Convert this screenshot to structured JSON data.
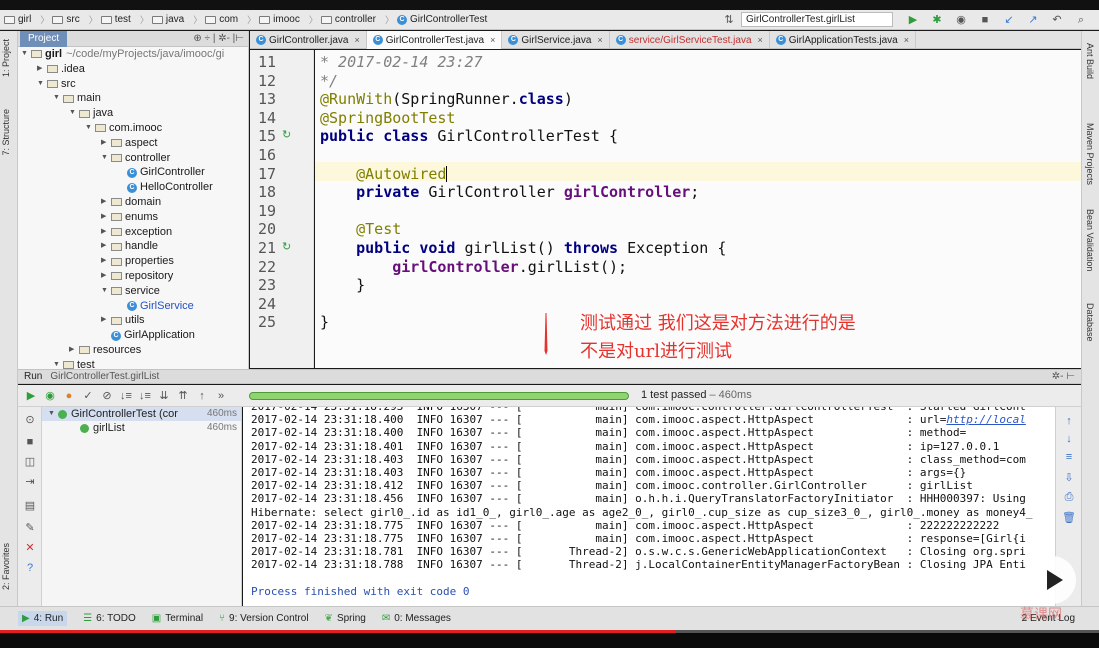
{
  "breadcrumb": [
    {
      "label": "girl",
      "icon": "folder-icon"
    },
    {
      "label": "src",
      "icon": "folder-icon"
    },
    {
      "label": "test",
      "icon": "folder-icon"
    },
    {
      "label": "java",
      "icon": "folder-icon"
    },
    {
      "label": "com",
      "icon": "folder-icon"
    },
    {
      "label": "imooc",
      "icon": "folder-icon"
    },
    {
      "label": "controller",
      "icon": "folder-icon"
    },
    {
      "label": "GirlControllerTest",
      "icon": "class-icon"
    }
  ],
  "run_config": "GirlControllerTest.girlList",
  "left_strip": {
    "project": "1: Project",
    "structure": "7: Structure",
    "favorites": "2: Favorites"
  },
  "right_strip": {
    "ant": "Ant Build",
    "maven": "Maven Projects",
    "bean": "Bean Validation",
    "database": "Database"
  },
  "project_panel": {
    "tab": "Project",
    "root": {
      "name": "girl",
      "path": "~/code/myProjects/java/imooc/gi"
    },
    "nodes": [
      {
        "label": ".idea",
        "indent": 1,
        "arrow": "▶",
        "kind": "folder"
      },
      {
        "label": "src",
        "indent": 1,
        "arrow": "▼",
        "kind": "folder"
      },
      {
        "label": "main",
        "indent": 2,
        "arrow": "▼",
        "kind": "folder"
      },
      {
        "label": "java",
        "indent": 3,
        "arrow": "▼",
        "kind": "folder"
      },
      {
        "label": "com.imooc",
        "indent": 4,
        "arrow": "▼",
        "kind": "package"
      },
      {
        "label": "aspect",
        "indent": 5,
        "arrow": "▶",
        "kind": "package"
      },
      {
        "label": "controller",
        "indent": 5,
        "arrow": "▼",
        "kind": "package"
      },
      {
        "label": "GirlController",
        "indent": 6,
        "arrow": "",
        "kind": "class"
      },
      {
        "label": "HelloController",
        "indent": 6,
        "arrow": "",
        "kind": "class"
      },
      {
        "label": "domain",
        "indent": 5,
        "arrow": "▶",
        "kind": "package"
      },
      {
        "label": "enums",
        "indent": 5,
        "arrow": "▶",
        "kind": "package"
      },
      {
        "label": "exception",
        "indent": 5,
        "arrow": "▶",
        "kind": "package"
      },
      {
        "label": "handle",
        "indent": 5,
        "arrow": "▶",
        "kind": "package"
      },
      {
        "label": "properties",
        "indent": 5,
        "arrow": "▶",
        "kind": "package"
      },
      {
        "label": "repository",
        "indent": 5,
        "arrow": "▶",
        "kind": "package"
      },
      {
        "label": "service",
        "indent": 5,
        "arrow": "▼",
        "kind": "package"
      },
      {
        "label": "GirlService",
        "indent": 6,
        "arrow": "",
        "kind": "class-blue"
      },
      {
        "label": "utils",
        "indent": 5,
        "arrow": "▶",
        "kind": "package"
      },
      {
        "label": "GirlApplication",
        "indent": 5,
        "arrow": "",
        "kind": "class"
      },
      {
        "label": "resources",
        "indent": 3,
        "arrow": "▶",
        "kind": "folder"
      },
      {
        "label": "test",
        "indent": 2,
        "arrow": "▼",
        "kind": "folder"
      }
    ]
  },
  "editor_tabs": [
    {
      "label": "GirlController.java",
      "active": false,
      "red": false
    },
    {
      "label": "GirlControllerTest.java",
      "active": true,
      "red": false
    },
    {
      "label": "GirlService.java",
      "active": false,
      "red": false
    },
    {
      "label": "service/GirlServiceTest.java",
      "active": false,
      "red": true
    },
    {
      "label": "GirlApplicationTests.java",
      "active": false,
      "red": false
    }
  ],
  "code": {
    "line_numbers": [
      "11",
      "12",
      "13",
      "14",
      "15",
      "16",
      "17",
      "18",
      "19",
      "20",
      "21",
      "22",
      "23",
      "24",
      "25"
    ],
    "lines": [
      [
        {
          "t": "* 2017-02-14 23:27",
          "c": "cm"
        }
      ],
      [
        {
          "t": "*/",
          "c": "cm"
        }
      ],
      [
        {
          "t": "@RunWith",
          "c": "ann"
        },
        {
          "t": "(SpringRunner.",
          "c": ""
        },
        {
          "t": "class",
          "c": "kw"
        },
        {
          "t": ")",
          "c": ""
        }
      ],
      [
        {
          "t": "@SpringBootTest",
          "c": "ann"
        }
      ],
      [
        {
          "t": "public class ",
          "c": "kw"
        },
        {
          "t": "GirlControllerTest {",
          "c": ""
        }
      ],
      [
        {
          "t": "",
          "c": ""
        }
      ],
      [
        {
          "t": "    ",
          "c": ""
        },
        {
          "t": "@Autowired",
          "c": "ann"
        }
      ],
      [
        {
          "t": "    ",
          "c": ""
        },
        {
          "t": "private ",
          "c": "kw"
        },
        {
          "t": "GirlController ",
          "c": ""
        },
        {
          "t": "girlController",
          "c": "fld"
        },
        {
          "t": ";",
          "c": ""
        }
      ],
      [
        {
          "t": "",
          "c": ""
        }
      ],
      [
        {
          "t": "    ",
          "c": ""
        },
        {
          "t": "@Test",
          "c": "ann"
        }
      ],
      [
        {
          "t": "    ",
          "c": ""
        },
        {
          "t": "public void ",
          "c": "kw"
        },
        {
          "t": "girlList() ",
          "c": ""
        },
        {
          "t": "throws ",
          "c": "kw"
        },
        {
          "t": "Exception {",
          "c": ""
        }
      ],
      [
        {
          "t": "        ",
          "c": ""
        },
        {
          "t": "girlController",
          "c": "fld"
        },
        {
          "t": ".girlList();",
          "c": ""
        }
      ],
      [
        {
          "t": "    }",
          "c": ""
        }
      ],
      [
        {
          "t": "",
          "c": ""
        }
      ],
      [
        {
          "t": "}",
          "c": ""
        }
      ]
    ]
  },
  "annotation_overlay": {
    "line1": "测试通过   我们这是对方法进行的是",
    "line2": "不是对url进行测试"
  },
  "run_panel": {
    "label": "Run",
    "config": "GirlControllerTest.girlList",
    "status": "1 test passed",
    "duration": "– 460ms",
    "tests": [
      {
        "name": "GirlControllerTest (cor",
        "time": "460ms",
        "indent": 0
      },
      {
        "name": "girlList",
        "time": "460ms",
        "indent": 1
      }
    ]
  },
  "console": [
    "2017-02-14 23:31:18.293  INFO 16307 --- [           main] com.imooc.controller.GirlControllerTest  : Started GirlCont",
    "2017-02-14 23:31:18.400  INFO 16307 --- [           main] com.imooc.aspect.HttpAspect              : url=http://local",
    "2017-02-14 23:31:18.400  INFO 16307 --- [           main] com.imooc.aspect.HttpAspect              : method=",
    "2017-02-14 23:31:18.401  INFO 16307 --- [           main] com.imooc.aspect.HttpAspect              : ip=127.0.0.1",
    "2017-02-14 23:31:18.403  INFO 16307 --- [           main] com.imooc.aspect.HttpAspect              : class_method=com",
    "2017-02-14 23:31:18.403  INFO 16307 --- [           main] com.imooc.aspect.HttpAspect              : args={}",
    "2017-02-14 23:31:18.412  INFO 16307 --- [           main] com.imooc.controller.GirlController      : girlList",
    "2017-02-14 23:31:18.456  INFO 16307 --- [           main] o.h.h.i.QueryTranslatorFactoryInitiator  : HHH000397: Using",
    "Hibernate: select girl0_.id as id1_0_, girl0_.age as age2_0_, girl0_.cup_size as cup_size3_0_, girl0_.money as money4_",
    "2017-02-14 23:31:18.775  INFO 16307 --- [           main] com.imooc.aspect.HttpAspect              : 222222222222",
    "2017-02-14 23:31:18.775  INFO 16307 --- [           main] com.imooc.aspect.HttpAspect              : response=[Girl{i",
    "2017-02-14 23:31:18.781  INFO 16307 --- [       Thread-2] o.s.w.c.s.GenericWebApplicationContext   : Closing org.spri",
    "2017-02-14 23:31:18.788  INFO 16307 --- [       Thread-2] j.LocalContainerEntityManagerFactoryBean : Closing JPA Enti",
    "",
    "Process finished with exit code 0"
  ],
  "bottom_tabs": [
    {
      "label": "4: Run",
      "active": true
    },
    {
      "label": "6: TODO",
      "active": false
    },
    {
      "label": "Terminal",
      "active": false
    },
    {
      "label": "9: Version Control",
      "active": false
    },
    {
      "label": "Spring",
      "active": false
    },
    {
      "label": "0: Messages",
      "active": false
    }
  ],
  "event_log": "2  Event Log",
  "watermark": "慕课网",
  "colors": {
    "accent": "#6f8fb8",
    "pass": "#4caf50",
    "overlay": "#e5322d"
  }
}
